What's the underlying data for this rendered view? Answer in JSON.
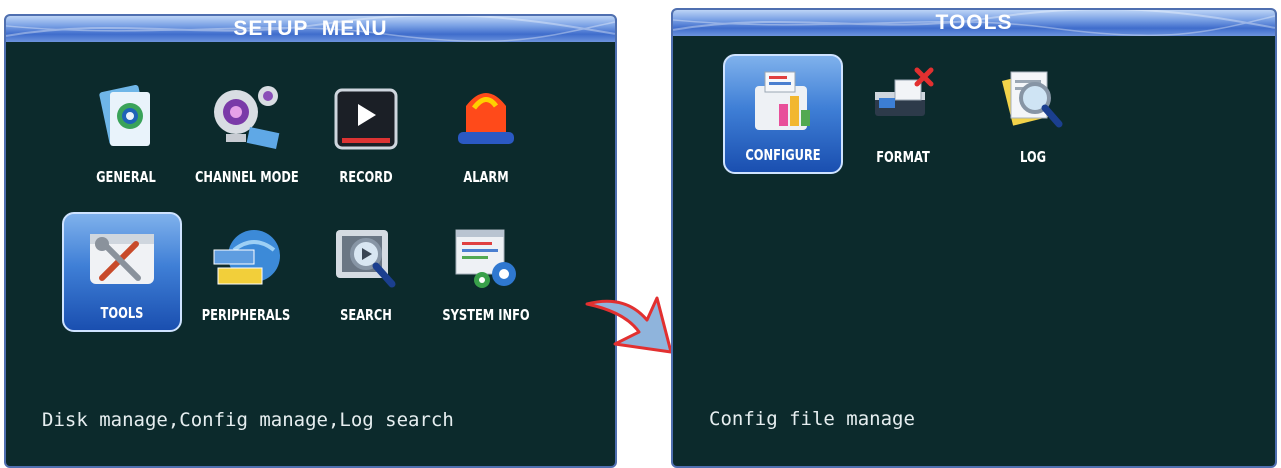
{
  "setup_menu": {
    "title": "SETUP  MENU",
    "tiles": [
      {
        "label": "GENERAL",
        "icon": "general-settings-icon"
      },
      {
        "label": "CHANNEL MODE",
        "icon": "webcam-icon"
      },
      {
        "label": "RECORD",
        "icon": "play-video-icon"
      },
      {
        "label": "ALARM",
        "icon": "alarm-light-icon"
      },
      {
        "label": "TOOLS",
        "icon": "tools-icon",
        "selected": true
      },
      {
        "label": "PERIPHERALS",
        "icon": "globe-cards-icon"
      },
      {
        "label": "SEARCH",
        "icon": "search-film-icon"
      },
      {
        "label": "SYSTEM INFO",
        "icon": "system-info-icon"
      }
    ],
    "status": "Disk manage,Config manage,Log search"
  },
  "tools_menu": {
    "title": "TOOLS",
    "tiles": [
      {
        "label": "CONFIGURE",
        "icon": "configure-chart-icon",
        "selected": true
      },
      {
        "label": "FORMAT",
        "icon": "format-drive-icon"
      },
      {
        "label": "LOG",
        "icon": "log-search-icon"
      }
    ],
    "status": "Config file manage"
  },
  "colors": {
    "panel_bg": "#0c2a2c",
    "title_bar": "#3f6dcc",
    "selection": "#3f7fd6",
    "arrow_outline": "#e23030"
  }
}
